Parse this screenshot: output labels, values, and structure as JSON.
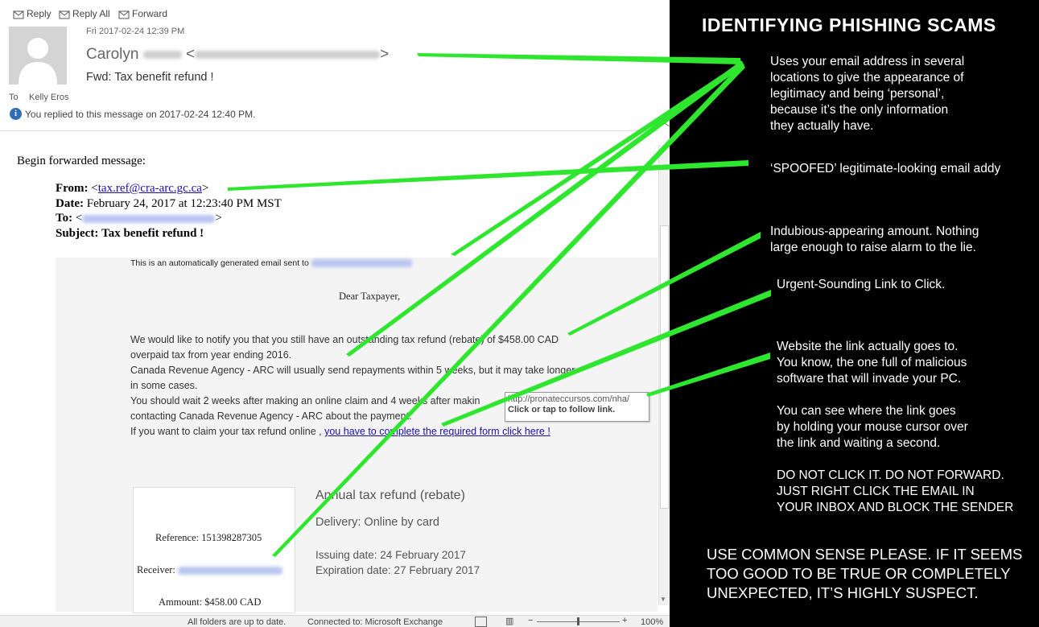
{
  "toolbar": {
    "reply": "Reply",
    "reply_all": "Reply All",
    "forward": "Forward"
  },
  "header": {
    "datetime": "Fri 2017-02-24 12:39 PM",
    "sender_first": "Carolyn",
    "subject": "Fwd: Tax benefit refund !",
    "to_label": "To",
    "to_name": "Kelly Eros",
    "replied_info": "You replied to this message on 2017-02-24 12:40 PM."
  },
  "forwarded": {
    "intro": "Begin forwarded message:",
    "from_label": "From:",
    "from_value": "tax.ref@cra-arc.gc.ca",
    "date_label": "Date:",
    "date_value": "February 24, 2017 at 12:23:40 PM MST",
    "to_label": "To:",
    "subject_label": "Subject:",
    "subject_value": "Tax benefit refund !"
  },
  "body": {
    "auto_notice": "This is an automatically generated email sent to",
    "greeting": "Dear Taxpayer,",
    "para1": "We would like to notify you that you still have an outstanding tax refund (rebate) of $458.00 CAD",
    "para2": "overpaid tax from year ending 2016.",
    "para3": "Canada Revenue Agency - ARC will usually send repayments within 5 weeks, but it may take longer",
    "para4": "in some cases.",
    "para5": "You should wait 2 weeks after making an online claim and 4 weeks after makin",
    "para6": "contacting Canada Revenue Agency - ARC about the payment.",
    "para7": "If you want to claim your tax refund online ,",
    "link_text": "you have to complete the required form click here !",
    "tooltip_url": "http://pronateccursos.com/nha/",
    "tooltip_hint": "Click or tap to follow link."
  },
  "card": {
    "reference": "Reference: 151398287305",
    "receiver_label": "Receiver:",
    "amount": "Ammount: $458.00 CAD",
    "title": "Annual tax refund (rebate)",
    "delivery": "Delivery: Online by card",
    "issuing": "Issuing date: 24 February 2017",
    "expiration": "Expiration date: 27 February 2017"
  },
  "status": {
    "folders": "All folders are up to date.",
    "connection": "Connected to: Microsoft Exchange",
    "zoom": "100%"
  },
  "annotations": {
    "title": "IDENTIFYING PHISHING SCAMS",
    "a1": "Uses your email address in several\nlocations to give the appearance of\nlegitimacy and being ‘personal’,\nbecause it’s the only information\nthey actually have.",
    "a2": "‘SPOOFED’ legitimate-looking email addy",
    "a3": "Indubious-appearing amount. Nothing\nlarge enough to raise alarm to the lie.",
    "a4": "Urgent-Sounding Link to Click.",
    "a5": "Website the link actually goes to.\nYou know, the one full of malicious\nsoftware that will invade your PC.\n\nYou can see where the link goes\nby holding your mouse cursor over\nthe link and waiting a second.\n\nDO NOT CLICK IT. DO NOT FORWARD.\nJUST RIGHT CLICK THE EMAIL IN\nYOUR INBOX AND BLOCK THE SENDER",
    "footer": "USE COMMON SENSE PLEASE. IF IT SEEMS\nTOO GOOD TO BE TRUE OR COMPLETELY\nUNEXPECTED, IT’S HIGHLY SUSPECT."
  },
  "colors": {
    "arrow": "#2ee62e",
    "link": "#1a0dab",
    "panel": "#000000"
  }
}
